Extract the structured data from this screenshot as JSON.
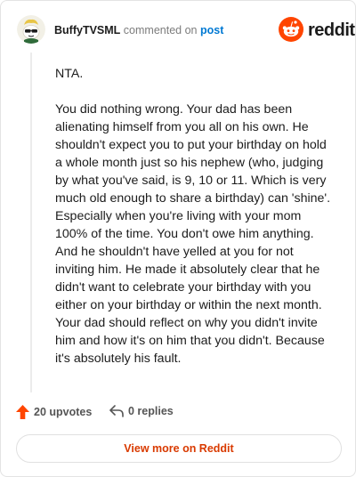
{
  "header": {
    "username": "BuffyTVSML",
    "action_text": "commented on",
    "post_link": "post",
    "logo_text": "reddit"
  },
  "comment": {
    "paragraphs": [
      "NTA.",
      "You did nothing wrong. Your dad has been alienating himself from you all on his own. He shouldn't expect you to put your birthday on hold a whole month just so his nephew (who, judging by what you've said, is 9, 10 or 11. Which is very much old enough to share a birthday) can 'shine'. Especially when you're living with your mom 100% of the time. You don't owe him anything. And he shouldn't have yelled at you for not inviting him. He made it absolutely clear that he didn't want to celebrate your birthday with you either on your birthday or within the next month. Your dad should reflect on why you didn't invite him and how it's on him that you didn't. Because it's absolutely his fault."
    ]
  },
  "actions": {
    "upvotes": "20 upvotes",
    "replies": "0 replies"
  },
  "footer": {
    "view_more": "View more on Reddit"
  },
  "colors": {
    "brand": "#ff4500",
    "link": "#0079d3",
    "button_text": "#d93a00"
  },
  "icons": {
    "avatar": "snoo-avatar-with-sunglasses",
    "logo": "reddit-logo-icon",
    "upvote": "upvote-arrow-icon",
    "reply": "reply-arrow-icon"
  }
}
